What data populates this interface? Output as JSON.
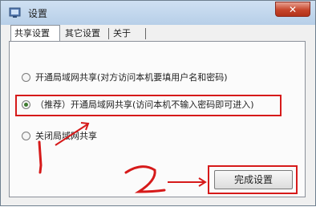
{
  "window": {
    "title": "设置",
    "close_label": "✕"
  },
  "tabs": [
    {
      "label": "共享设置"
    },
    {
      "label": "其它设置"
    },
    {
      "label": "关于"
    }
  ],
  "options": [
    {
      "label": "开通局域网共享(对方访问本机要填用户名和密码)",
      "checked": false
    },
    {
      "label": "（推荐）开通局域网共享(访问本机不输入密码即可进入)",
      "checked": true
    },
    {
      "label": "关闭局域网共享",
      "checked": false
    }
  ],
  "finish_label": "完成设置",
  "annotations": {
    "step1": "1",
    "step2": "2",
    "color": "#d61a1a"
  },
  "icons": [
    "window-settings-icon",
    "close-icon",
    "arrow-icon"
  ]
}
